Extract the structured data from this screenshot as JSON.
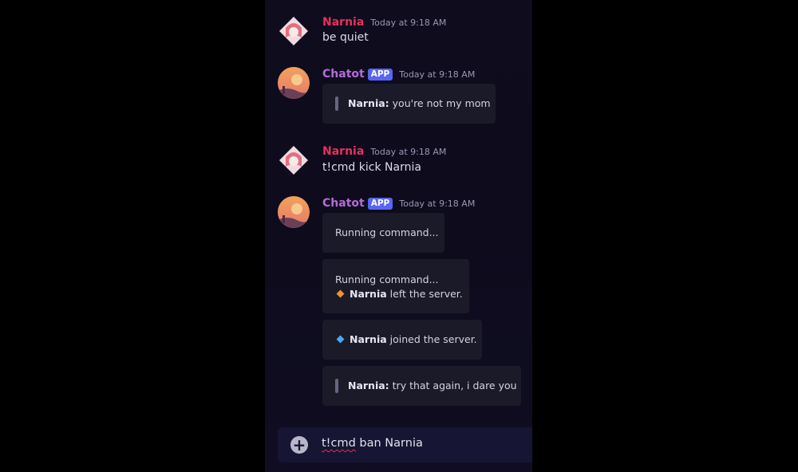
{
  "messages": [
    {
      "author": "Narnia",
      "timestamp": "Today at 9:18 AM",
      "text": "be quiet"
    },
    {
      "author": "Chatot",
      "badge": "APP",
      "timestamp": "Today at 9:18 AM",
      "quote": {
        "name": "Narnia:",
        "text": " you're not my mom"
      }
    },
    {
      "author": "Narnia",
      "timestamp": "Today at 9:18 AM",
      "text": "t!cmd kick Narnia"
    },
    {
      "author": "Chatot",
      "badge": "APP",
      "timestamp": "Today at 9:18 AM",
      "boxes": [
        {
          "line1": "Running command..."
        },
        {
          "line1": "Running command...",
          "event_name": "Narnia",
          "event_text": " left the server.",
          "event_color": "#f0922c"
        },
        {
          "event_name": "Narnia",
          "event_text": " joined the server.",
          "event_color": "#4aa8f0"
        },
        {
          "quote_name": "Narnia:",
          "quote_text": " try that again, i dare you"
        }
      ]
    }
  ],
  "composer": {
    "word1": "t!cmd",
    "rest": " ban Narnia"
  },
  "colors": {
    "narnia": "#e8305a",
    "chatot": "#b76ad8",
    "badge": "#5865f2"
  },
  "icons": {
    "add": "plus-circle-icon"
  }
}
